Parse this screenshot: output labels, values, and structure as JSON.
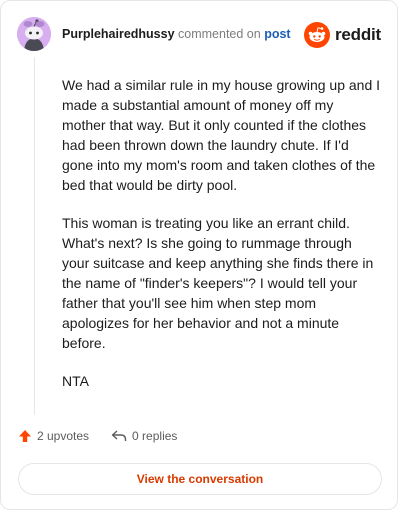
{
  "brand": {
    "logo_icon": "reddit-alien-icon",
    "logo_text": "reddit",
    "accent": "#ff4500"
  },
  "comment": {
    "author": "Purplehairedhussy",
    "action_text": " commented on ",
    "target_link": "post",
    "avatar_icon": "snoo-avatar",
    "paragraphs": [
      "We had a similar rule in my house growing up and I made a substantial amount of money off my mother that way. But it only counted if the clothes had been thrown down the laundry chute. If I'd gone into my mom's room and taken clothes of the bed that would be dirty pool.",
      "This woman is treating you like an errant child. What's next? Is she going to rummage through your suitcase and keep anything she finds there in the name of \"finder's keepers\"? I would tell your father that you'll see him when step mom apologizes for her behavior and not a minute before.",
      "NTA"
    ]
  },
  "actions": {
    "upvotes_label": "2 upvotes",
    "upvote_icon": "upvote-arrow-icon",
    "replies_label": "0 replies",
    "reply_icon": "reply-arrow-icon"
  },
  "cta": {
    "view_label": "View the conversation"
  },
  "colors": {
    "link_blue": "#1a5fb4",
    "cta_orange": "#d93a00",
    "avatar_purple": "#d7aef0"
  }
}
